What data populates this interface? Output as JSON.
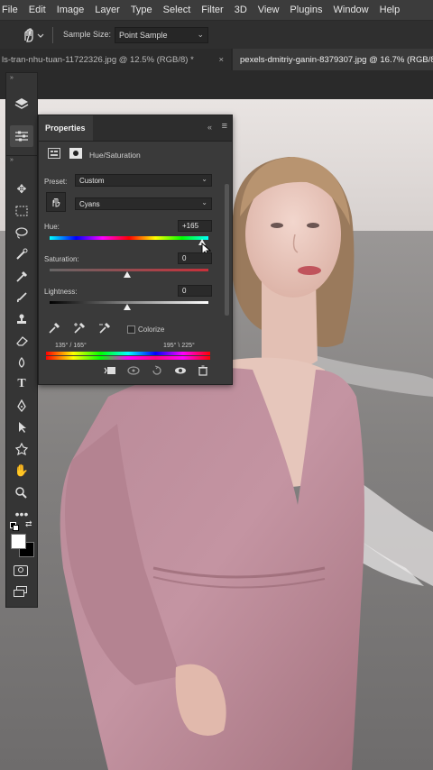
{
  "menu": [
    "File",
    "Edit",
    "Image",
    "Layer",
    "Type",
    "Select",
    "Filter",
    "3D",
    "View",
    "Plugins",
    "Window",
    "Help"
  ],
  "options": {
    "sample_label": "Sample Size:",
    "sample_value": "Point Sample"
  },
  "tabs": [
    {
      "label": "ls-tran-nhu-tuan-11722326.jpg @ 12.5% (RGB/8) *"
    },
    {
      "label": "pexels-dmitriy-ganin-8379307.jpg @ 16.7% (RGB/8"
    }
  ],
  "properties": {
    "tab": "Properties",
    "adjustment": "Hue/Saturation",
    "preset_label": "Preset:",
    "preset_value": "Custom",
    "channel_value": "Cyans",
    "hue_label": "Hue:",
    "hue_value": "+165",
    "hue_level": 165,
    "saturation_label": "Saturation:",
    "saturation_value": "0",
    "lightness_label": "Lightness:",
    "lightness_value": "0",
    "colorize_label": "Colorize",
    "range_left": "135° /  165°",
    "range_right": "195° \\  225°"
  },
  "colors": {
    "menubar": "#3c3c3c",
    "panel": "#3a3a3a",
    "accent_red": "#c9303a"
  },
  "icons": [
    "move-icon",
    "marquee-icon",
    "lasso-icon",
    "quick-select-icon",
    "eyedropper-icon",
    "brush-icon",
    "stamp-icon",
    "eraser-icon",
    "blur-icon",
    "type-icon",
    "pen-icon",
    "path-select-icon",
    "shape-icon",
    "hand-icon",
    "zoom-icon",
    "more-icon"
  ]
}
